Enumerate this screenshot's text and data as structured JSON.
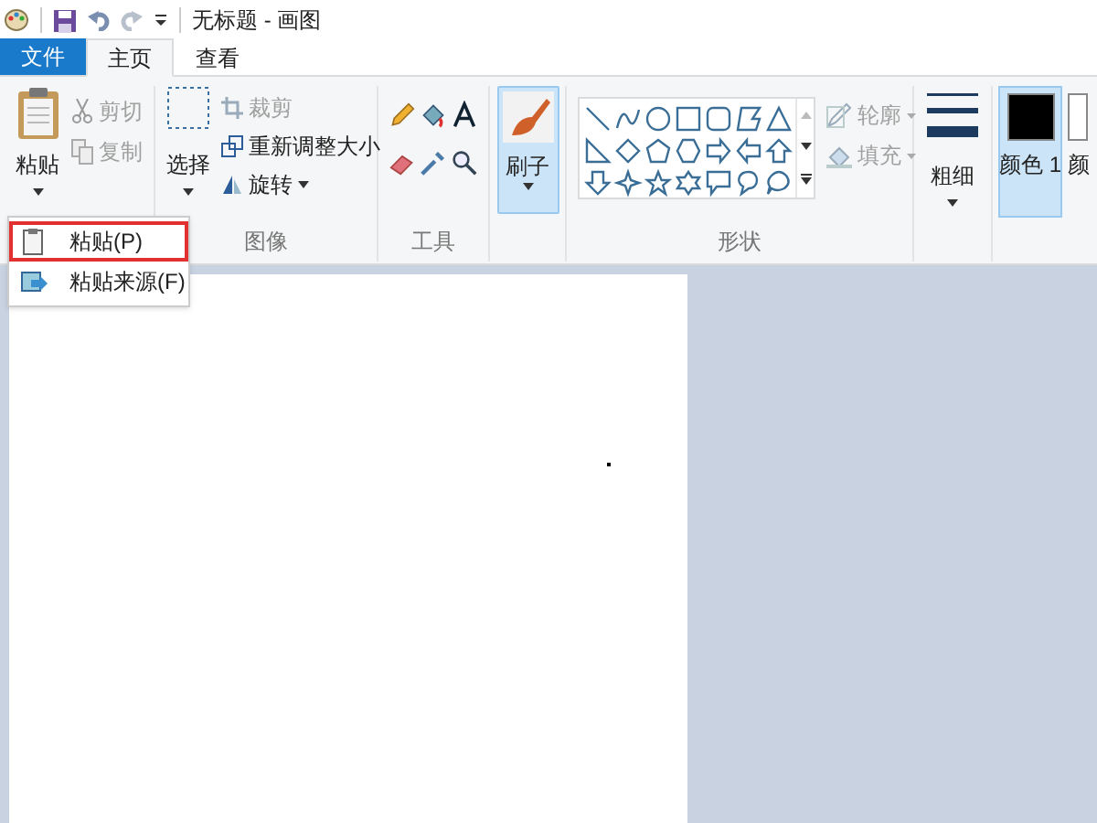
{
  "window": {
    "title": "无标题 - 画图"
  },
  "tabs": [
    {
      "label": "文件",
      "kind": "file",
      "selected": false
    },
    {
      "label": "主页",
      "kind": "tab",
      "selected": true
    },
    {
      "label": "查看",
      "kind": "tab",
      "selected": false
    }
  ],
  "clipboard": {
    "paste": "粘贴",
    "cut": {
      "label": "剪切",
      "disabled": true
    },
    "copy": {
      "label": "复制",
      "disabled": true
    }
  },
  "image": {
    "select": "选择",
    "crop": {
      "label": "裁剪",
      "disabled": true
    },
    "resize": {
      "label": "重新调整大小",
      "disabled": false
    },
    "rotate": {
      "label": "旋转",
      "disabled": false
    },
    "group_label": "图像"
  },
  "tools": {
    "group_label": "工具"
  },
  "brush": {
    "label": "刷子",
    "selected": true
  },
  "shapes": {
    "outline": {
      "label": "轮廓",
      "disabled": true
    },
    "fill": {
      "label": "填充",
      "disabled": true
    },
    "group_label": "形状"
  },
  "size": {
    "label": "粗细"
  },
  "colors": [
    {
      "label": "颜色 1",
      "color": "#000000",
      "selected": true
    },
    {
      "label": "颜",
      "color": "#ffffff",
      "selected": false
    }
  ],
  "paste_menu": [
    {
      "label": "粘贴(P)",
      "highlighted": true
    },
    {
      "label": "粘贴来源(F)",
      "highlighted": false
    }
  ]
}
